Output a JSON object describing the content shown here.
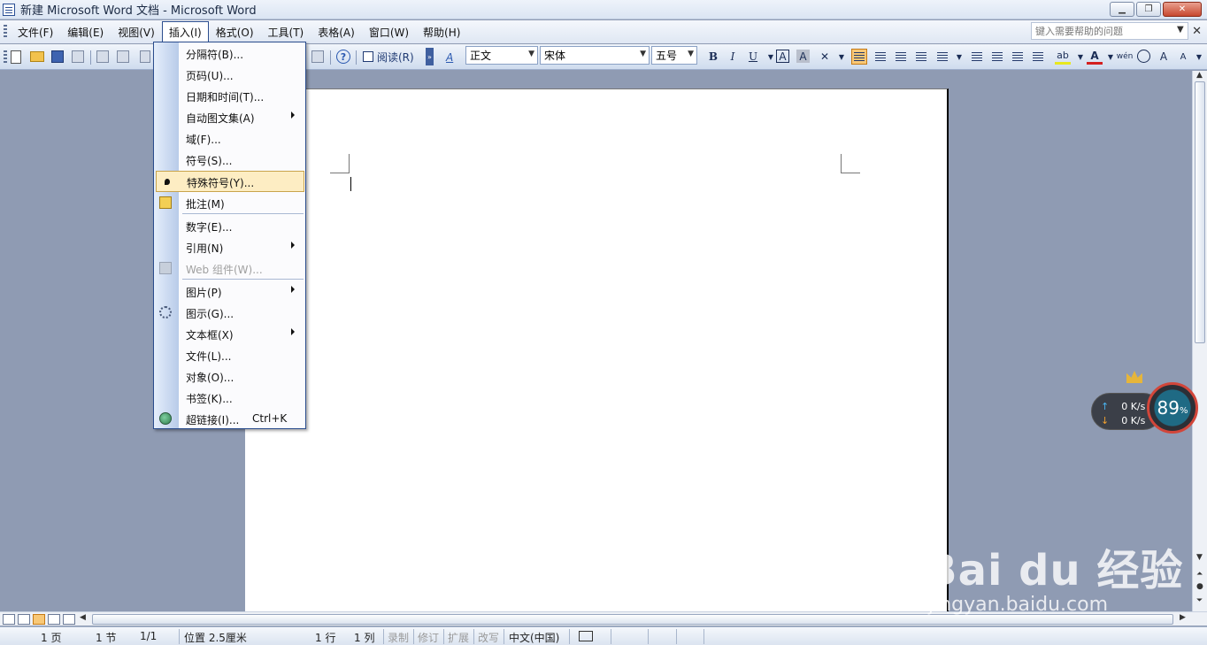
{
  "window": {
    "title": "新建 Microsoft Word 文档 - Microsoft Word",
    "minimize": "▁",
    "maximize": "❐",
    "close": "✕"
  },
  "menubar": {
    "items": [
      "文件(F)",
      "编辑(E)",
      "视图(V)",
      "插入(I)",
      "格式(O)",
      "工具(T)",
      "表格(A)",
      "窗口(W)",
      "帮助(H)"
    ],
    "help_placeholder": "键入需要帮助的问题",
    "close": "✕"
  },
  "toolbar": {
    "read_label": "阅读(R)",
    "style_value": "正文",
    "font_value": "宋体",
    "size_value": "五号",
    "bold": "B",
    "italic": "I",
    "underline": "U",
    "char_border": "A",
    "char_shade": "A",
    "font_color": "A",
    "highlight": "ab",
    "phonetic": "wén",
    "grow": "A",
    "shrink": "A",
    "styles_icon": "A"
  },
  "insert_menu": {
    "items": [
      {
        "label": "分隔符(B)..."
      },
      {
        "label": "页码(U)..."
      },
      {
        "label": "日期和时间(T)..."
      },
      {
        "label": "自动图文集(A)"
      },
      {
        "label": "域(F)..."
      },
      {
        "label": "符号(S)..."
      },
      {
        "label": "特殊符号(Y)..."
      },
      {
        "label": "批注(M)"
      },
      {
        "label": "数字(E)..."
      },
      {
        "label": "引用(N)"
      },
      {
        "label": "Web 组件(W)..."
      },
      {
        "label": "图片(P)"
      },
      {
        "label": "图示(G)..."
      },
      {
        "label": "文本框(X)"
      },
      {
        "label": "文件(L)..."
      },
      {
        "label": "对象(O)..."
      },
      {
        "label": "书签(K)..."
      },
      {
        "label": "超链接(I)...",
        "shortcut": "Ctrl+K"
      }
    ]
  },
  "statusbar": {
    "page": "1 页",
    "section": "1 节",
    "page_of": "1/1",
    "position": "位置 2.5厘米",
    "line": "1 行",
    "column": "1 列",
    "rec": "录制",
    "trk": "修订",
    "ext": "扩展",
    "ovr": "改写",
    "language": "中文(中国)"
  },
  "speed_widget": {
    "upload": "0 K/s",
    "download": "0 K/s",
    "percent": "89",
    "percent_sign": "%"
  },
  "watermark": {
    "brand": "Bai du 经验",
    "site": "jingyan.baidu.com"
  },
  "colors": {
    "menu_border": "#2b4d8e",
    "highlight": "#fdedc3",
    "doc_bg": "#8f9bb3"
  }
}
